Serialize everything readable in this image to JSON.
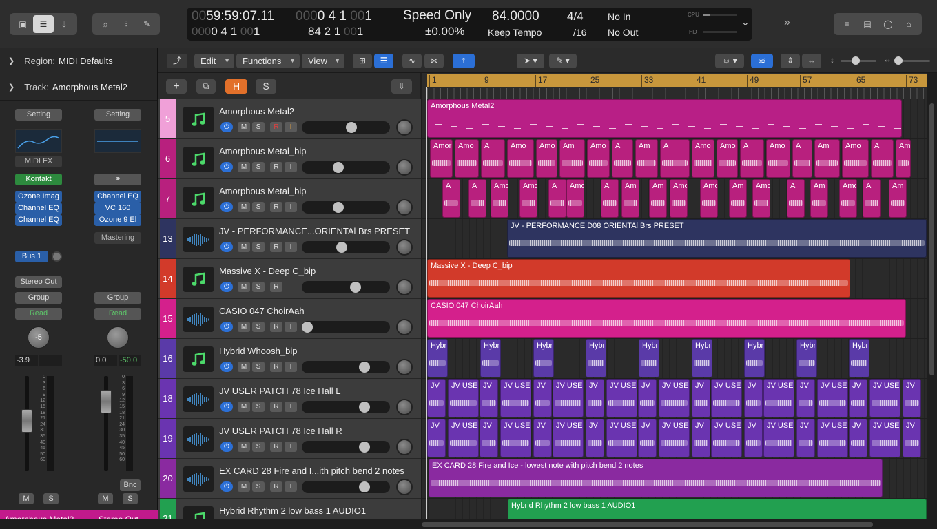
{
  "lcd": {
    "time": "59:59:07.11",
    "time_dim": "00",
    "bars": "0 4 1",
    "bars_dim": "000",
    "bars_tick": "1",
    "bars_tick_dim": "00",
    "bars2": "0 4 1",
    "bars2_dim": "000",
    "bars2_tick": "1",
    "bars2_tick_dim": "00",
    "mode": "Speed Only",
    "percent": "±0.00%",
    "tempo": "84.0000",
    "tempo_mode": "Keep Tempo",
    "pos2": "84 2 1",
    "pos2_tick": "1",
    "pos2_tick_dim": "00",
    "sig": "4/4",
    "div": "/16",
    "in": "No In",
    "out": "No Out",
    "cpu": "CPU",
    "hd": "HD"
  },
  "inspector": {
    "region_label": "Region:",
    "region_value": "MIDI Defaults",
    "track_label": "Track:",
    "track_value": "Amorphous Metal2"
  },
  "strip1": {
    "setting": "Setting",
    "midifx": "MIDI FX",
    "instrument": "Kontakt",
    "inserts": [
      "Ozone Imag",
      "Channel EQ",
      "Channel EQ"
    ],
    "send": "Bus 1",
    "output": "Stereo Out",
    "group": "Group",
    "auto": "Read",
    "pan": "-5",
    "vol": "-3.9",
    "m": "M",
    "s": "S",
    "name": "Amorphous Metal2"
  },
  "strip2": {
    "setting": "Setting",
    "inserts": [
      "Channel EQ",
      "VC 160",
      "Ozone 9 El"
    ],
    "mastering": "Mastering",
    "group": "Group",
    "auto": "Read",
    "vol": "0.0",
    "peak": "-50.0",
    "bnc": "Bnc",
    "m": "M",
    "s": "S",
    "name": "Stereo Out"
  },
  "scale": [
    "0",
    "3",
    "6",
    "9",
    "12",
    "15",
    "18",
    "21",
    "24",
    "30",
    "35",
    "40",
    "45",
    "50",
    "60"
  ],
  "menu": {
    "edit": "Edit",
    "functions": "Functions",
    "view": "View"
  },
  "trackbar": {
    "h": "H",
    "s": "S",
    "plus": "+"
  },
  "ruler": [
    "1",
    "9",
    "17",
    "25",
    "33",
    "41",
    "49",
    "57",
    "65",
    "73"
  ],
  "tracks": [
    {
      "num": "5",
      "name": "Amorphous Metal2",
      "type": "midi",
      "color": "#f0a0d8"
    },
    {
      "num": "6",
      "name": "Amorphous Metal_bip",
      "type": "midi",
      "color": "#b8207e"
    },
    {
      "num": "7",
      "name": "Amorphous Metal_bip",
      "type": "midi",
      "color": "#b8207e"
    },
    {
      "num": "13",
      "name": "JV - PERFORMANCE...ORIENTAl Brs PRESET",
      "type": "audio",
      "color": "#2e3460"
    },
    {
      "num": "14",
      "name": "Massive X - Deep C_bip",
      "type": "midi",
      "color": "#d23a2a"
    },
    {
      "num": "15",
      "name": "CASIO 047 ChoirAah",
      "type": "audio",
      "color": "#d4208c"
    },
    {
      "num": "16",
      "name": "Hybrid Whoosh_bip",
      "type": "midi",
      "color": "#5a3aa8"
    },
    {
      "num": "18",
      "name": "JV USER PATCH 78 Ice Hall L",
      "type": "audio",
      "color": "#6a34b0"
    },
    {
      "num": "19",
      "name": "JV USER PATCH 78 Ice Hall R",
      "type": "audio",
      "color": "#6a34b0"
    },
    {
      "num": "20",
      "name": "EX CARD 28 Fire and I...ith pitch bend 2 notes",
      "type": "audio",
      "color": "#8a2aa0"
    },
    {
      "num": "21",
      "name": "Hybrid Rhythm 2 low bass 1 AUDIO1",
      "type": "midi",
      "color": "#22a050"
    }
  ],
  "buttons": {
    "m": "M",
    "s": "S",
    "r": "R",
    "i": "I"
  },
  "regions": {
    "r5": "Amorphous Metal2",
    "r6": [
      "Amor",
      "Amo",
      "A",
      "Amo",
      "Amo",
      "Am",
      "Amo",
      "A",
      "Am",
      "A",
      "Amo",
      "Amo",
      "A",
      "Amo",
      "A",
      "Am",
      "Amo",
      "A",
      "Am"
    ],
    "r7": [
      "A",
      "A",
      "Amo",
      "Amo",
      "A",
      "Amor",
      "A",
      "Am",
      "Am",
      "Amo",
      "Amo",
      "Am",
      "Amo",
      "A",
      "Am",
      "Amo",
      "A",
      "Am"
    ],
    "r13": "JV - PERFORMANCE D08 ORIENTAl Brs PRESET",
    "r14": "Massive X - Deep C_bip",
    "r15": "CASIO 047 ChoirAah",
    "r16": [
      "Hybr",
      "Hybr",
      "Hybr",
      "Hybr",
      "Hybr",
      "Hybr",
      "Hybr",
      "Hybr",
      "Hybr"
    ],
    "r18": [
      "JV",
      "JV USE",
      "JV",
      "JV USE",
      "JV",
      "JV USE",
      "JV",
      "JV USE",
      "JV",
      "JV USE",
      "JV",
      "JV USE",
      "JV",
      "JV USE",
      "JV",
      "JV USE",
      "JV",
      "JV USE",
      "JV"
    ],
    "r20": "EX CARD 28 Fire and Ice - lowest note with pitch bend 2 notes",
    "r21": "Hybrid Rhythm 2 low bass 1 AUDIO1"
  }
}
